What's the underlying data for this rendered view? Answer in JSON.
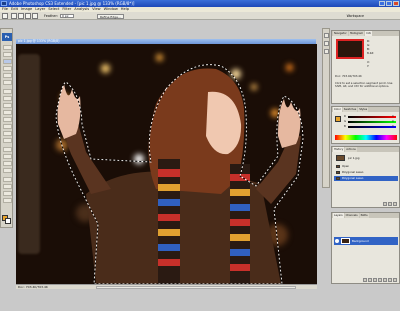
{
  "window": {
    "title": "Adobe Photoshop CS3 Extended - [pic 1.jpg @ 133% (RGB/8*)]"
  },
  "menu": [
    "File",
    "Edit",
    "Image",
    "Layer",
    "Select",
    "Filter",
    "Analysis",
    "View",
    "Window",
    "Help"
  ],
  "options": {
    "feather_label": "Feather:",
    "feather_value": "0 px",
    "refine_edge_label": "Refine Edge...",
    "workspace_label": "Workspace"
  },
  "tools": {
    "logo": "Ps"
  },
  "document": {
    "tab_title": "pic 1.jpg @ 133% (RGB/8)",
    "status_text": "Doc: 703.4K/703.4K"
  },
  "navigator": {
    "tabs": [
      "Navigator",
      "Histogram",
      "Info"
    ],
    "rows": [
      "R:",
      "G:",
      "B:",
      "8-bit",
      "X:",
      "Y:"
    ],
    "doc_text": "Doc: 703.4K/703.4K",
    "hint": "Click to set a selection segment point. Use Shift, Alt, and Ctrl for additional options."
  },
  "color": {
    "tabs": [
      "Color",
      "Swatches",
      "Styles"
    ],
    "channels": [
      "R",
      "G",
      "B"
    ],
    "values": [
      "0",
      "0",
      "0"
    ]
  },
  "history": {
    "tabs": [
      "History",
      "Actions"
    ],
    "snapshot": "pic 1.jpg",
    "items": [
      {
        "label": "Open",
        "selected": false
      },
      {
        "label": "Polygonal Lasso",
        "selected": false
      },
      {
        "label": "Polygonal Lasso",
        "selected": true
      }
    ]
  },
  "layers": {
    "tabs": [
      "Layers",
      "Channels",
      "Paths"
    ],
    "items": [
      {
        "label": "Background",
        "selected": true
      }
    ]
  }
}
